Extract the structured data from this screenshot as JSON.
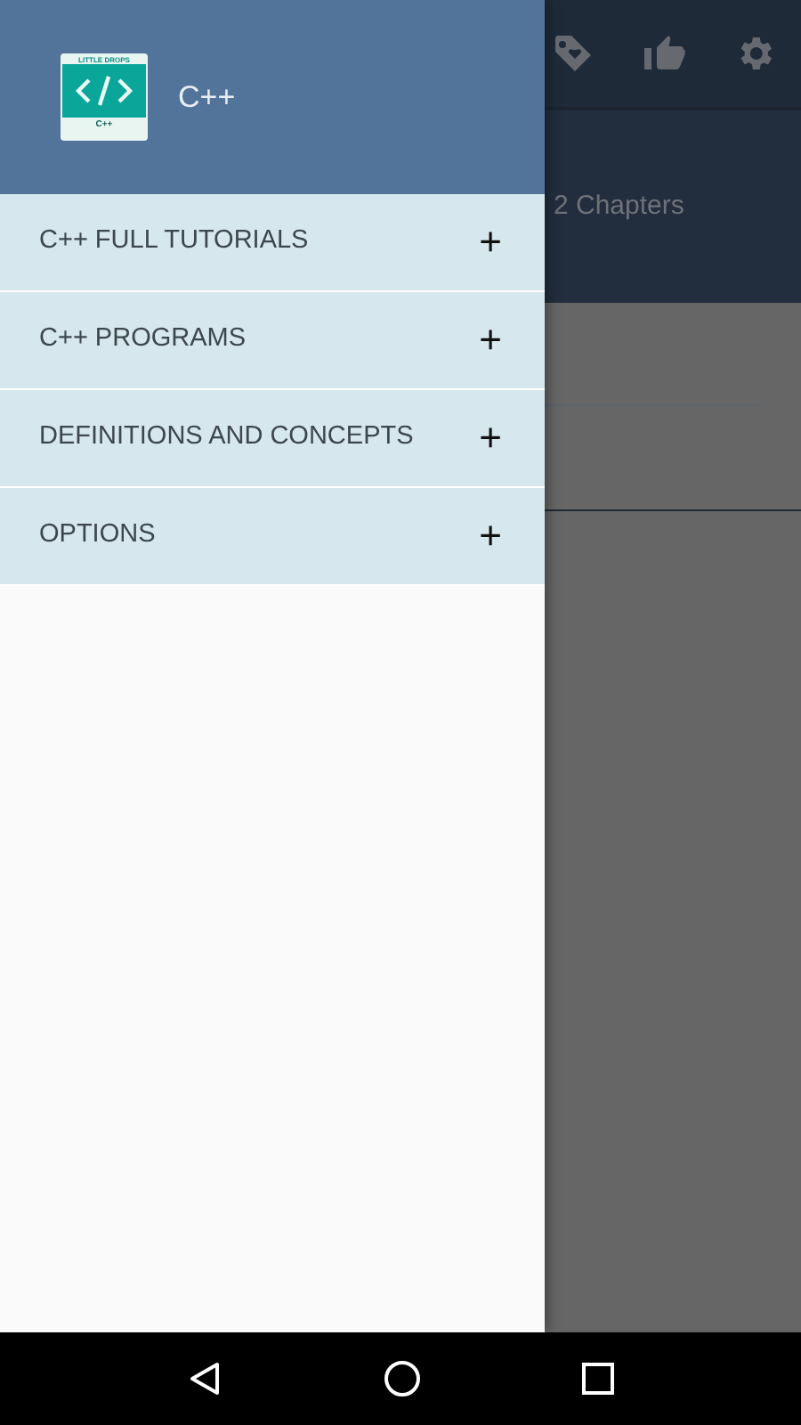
{
  "background": {
    "subtitle": "2 Chapters"
  },
  "drawer": {
    "logo": {
      "top_text": "LITTLE DROPS",
      "bottom_text": "C++"
    },
    "title": "C++",
    "items": [
      {
        "label": "C++ FULL TUTORIALS",
        "toggle": "+"
      },
      {
        "label": "C++ PROGRAMS",
        "toggle": "+"
      },
      {
        "label": "DEFINITIONS AND CONCEPTS",
        "toggle": "+"
      },
      {
        "label": "OPTIONS",
        "toggle": "+"
      }
    ]
  }
}
